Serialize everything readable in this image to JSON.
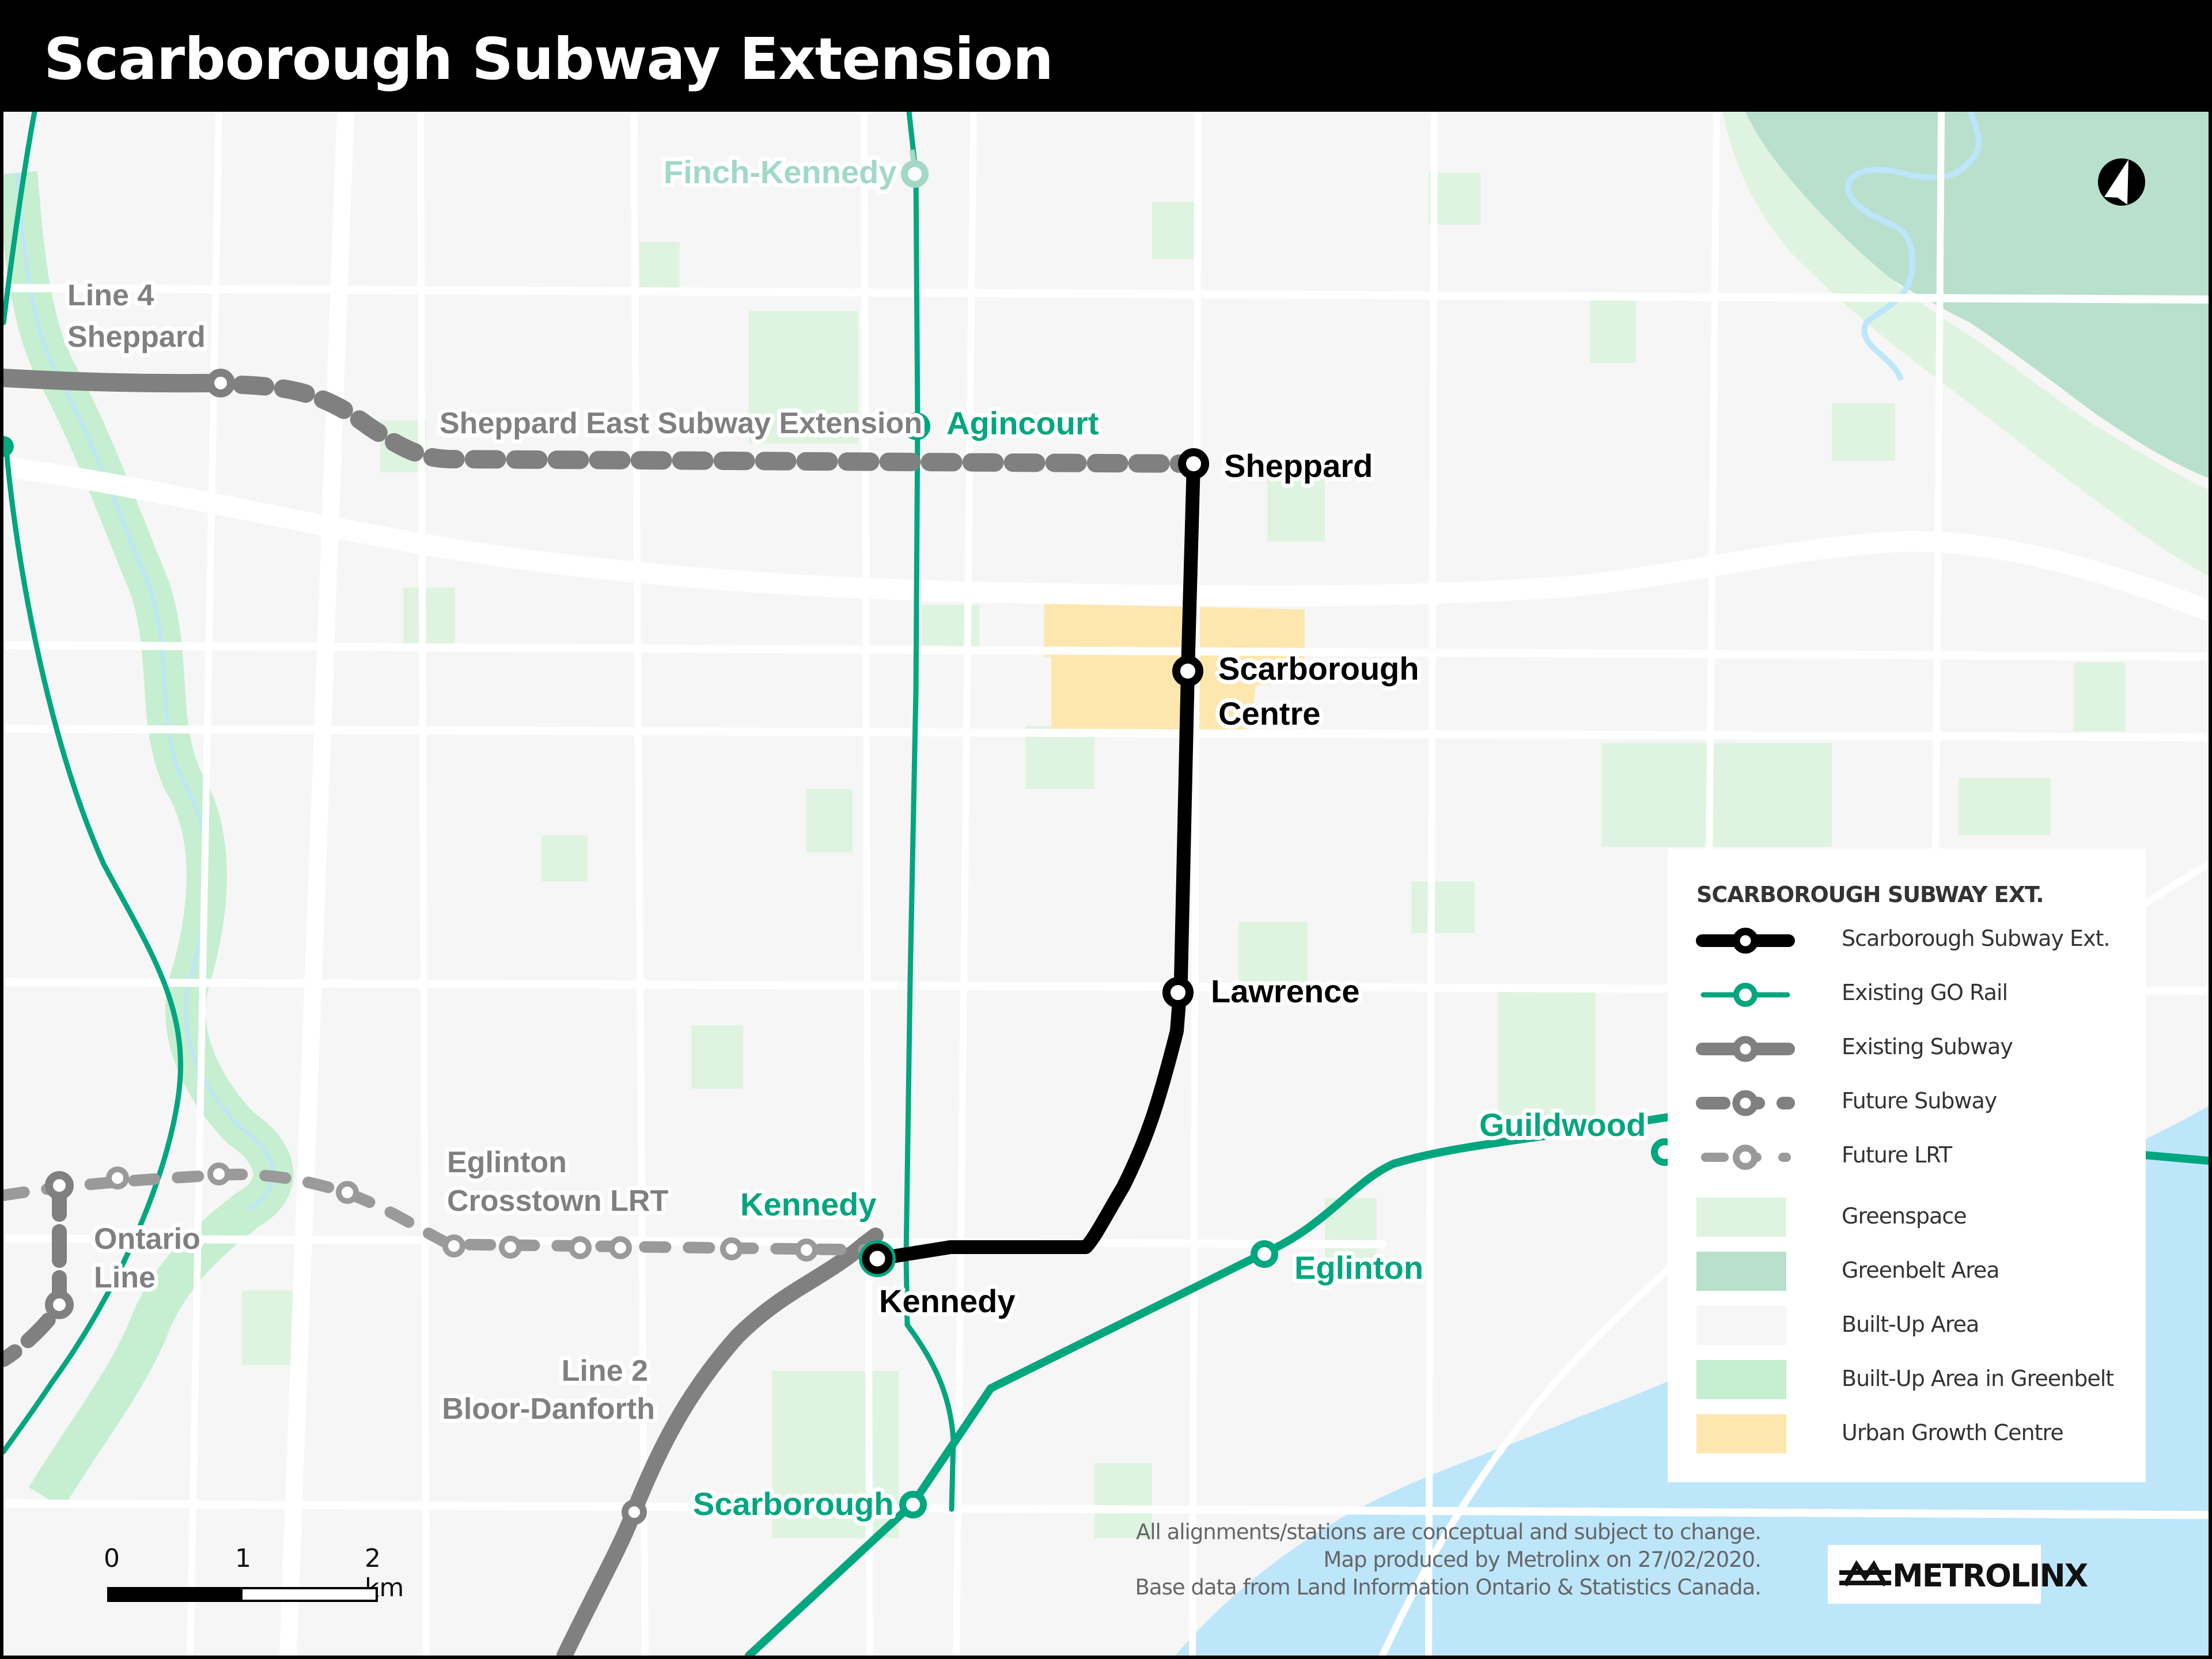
{
  "title": "Scarborough Subway Extension",
  "colors": {
    "sse": "#000000",
    "go_rail": "#00a67e",
    "go_rail_faded": "#a1d9c4",
    "subway": "#808080",
    "future_lrt": "#9a9a9a",
    "greenspace": "#dff4e0",
    "greenbelt": "#b8e0cd",
    "built_up": "#f6f6f6",
    "built_up_greenbelt": "#c5efd0",
    "urban_growth": "#fde7ae",
    "water": "#bde6fb"
  },
  "stations": {
    "sse": [
      {
        "name": "Sheppard"
      },
      {
        "name": "Scarborough Centre"
      },
      {
        "name": "Lawrence"
      },
      {
        "name": "Kennedy"
      }
    ],
    "go": [
      {
        "name": "Finch-Kennedy"
      },
      {
        "name": "Agincourt"
      },
      {
        "name": "Kennedy"
      },
      {
        "name": "Eglinton"
      },
      {
        "name": "Guildwood"
      },
      {
        "name": "Scarborough"
      }
    ]
  },
  "labels": {
    "sheppard": "Sheppard",
    "scarborough_centre_1": "Scarborough",
    "scarborough_centre_2": "Centre",
    "lawrence": "Lawrence",
    "kennedy_sse": "Kennedy",
    "kennedy_go": "Kennedy",
    "finch_kennedy": "Finch-Kennedy",
    "agincourt": "Agincourt",
    "eglinton_go": "Eglinton",
    "guildwood": "Guildwood",
    "scarborough_go": "Scarborough",
    "line4_1": "Line 4",
    "line4_2": "Sheppard",
    "sheppard_east": "Sheppard East Subway Extension",
    "eglinton_lrt_1": "Eglinton",
    "eglinton_lrt_2": "Crosstown LRT",
    "ontario_line_1": "Ontario",
    "ontario_line_2": "Line",
    "line2_1": "Line 2",
    "line2_2": "Bloor-Danforth"
  },
  "legend": {
    "title": "SCARBOROUGH SUBWAY EXT.",
    "items": [
      {
        "label": "Scarborough Subway Ext.",
        "type": "sse"
      },
      {
        "label": "Existing GO Rail",
        "type": "go"
      },
      {
        "label": "Existing Subway",
        "type": "subway"
      },
      {
        "label": "Future Subway",
        "type": "future_subway"
      },
      {
        "label": "Future LRT",
        "type": "future_lrt"
      },
      {
        "label": "Greenspace",
        "type": "swatch",
        "color": "#dff4e0"
      },
      {
        "label": "Greenbelt Area",
        "type": "swatch",
        "color": "#b8e0cd"
      },
      {
        "label": "Built-Up Area",
        "type": "swatch",
        "color": "#f6f6f6"
      },
      {
        "label": "Built-Up Area in Greenbelt",
        "type": "swatch",
        "color": "#c5efd0"
      },
      {
        "label": "Urban Growth Centre",
        "type": "swatch",
        "color": "#fde7ae"
      }
    ]
  },
  "footnote": {
    "line1": "All alignments/stations are conceptual and subject to change.",
    "line2": "Map produced by Metrolinx on 27/02/2020.",
    "line3": "Base data from Land Information Ontario & Statistics Canada."
  },
  "logo": {
    "text": "METROLINX"
  },
  "scale": {
    "tick0": "0",
    "tick1": "1",
    "tick2": "2 km"
  },
  "compass": {
    "icon": "north-arrow-icon"
  }
}
